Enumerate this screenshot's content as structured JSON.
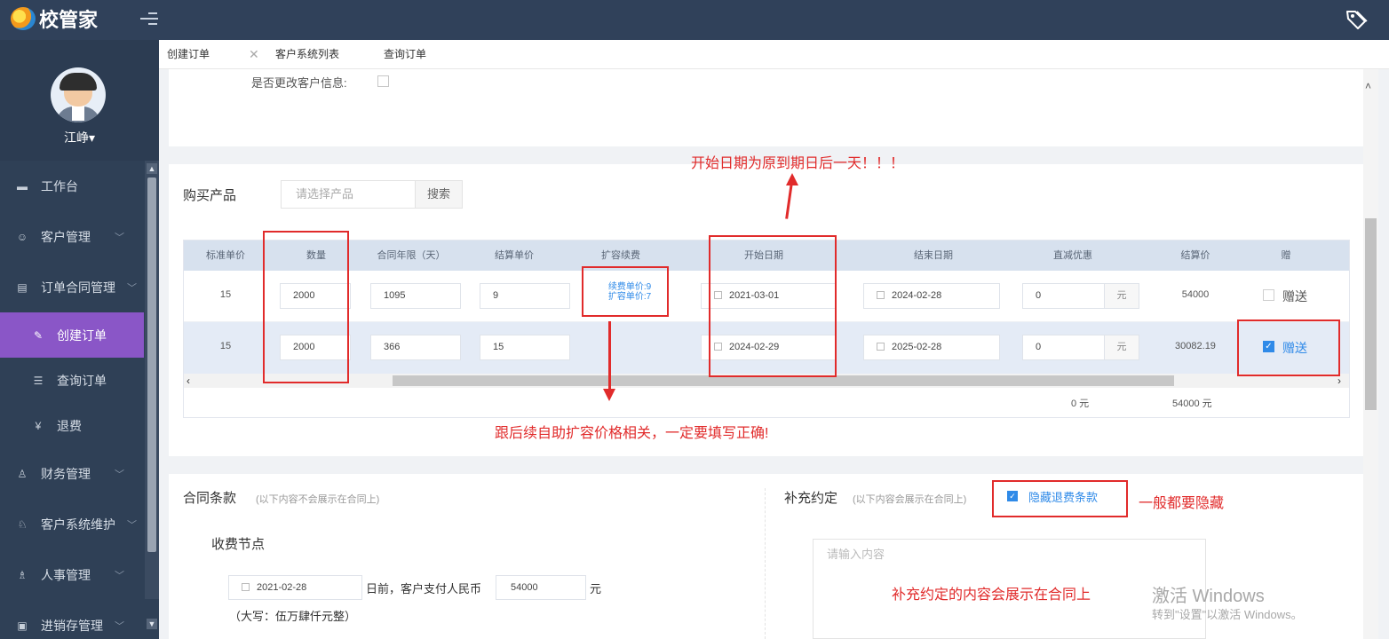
{
  "app": {
    "brand": "校管家"
  },
  "user": {
    "name": "江峥▾"
  },
  "sidebar": {
    "items": [
      {
        "label": "工作台",
        "icon": "desk-icon"
      },
      {
        "label": "客户管理",
        "icon": "customer-icon"
      },
      {
        "label": "订单合同管理",
        "icon": "contract-icon"
      },
      {
        "label": "创建订单",
        "icon": "create-order-icon",
        "active": true
      },
      {
        "label": "查询订单",
        "icon": "query-order-icon"
      },
      {
        "label": "退费",
        "icon": "refund-icon"
      },
      {
        "label": "财务管理",
        "icon": "finance-icon"
      },
      {
        "label": "客户系统维护",
        "icon": "maintenance-icon"
      },
      {
        "label": "人事管理",
        "icon": "hr-icon"
      },
      {
        "label": "进销存管理",
        "icon": "inventory-icon"
      }
    ]
  },
  "tabs": [
    {
      "label": "创建订单",
      "active": true
    },
    {
      "label": "客户系统列表"
    },
    {
      "label": "查询订单"
    }
  ],
  "form": {
    "partial_label": "是否更改客户信息:",
    "product_section": "购买产品",
    "product_placeholder": "请选择产品",
    "search_label": "搜索"
  },
  "table": {
    "headers": [
      "标准单价",
      "数量",
      "合同年限（天）",
      "结算单价",
      "扩容续费",
      "开始日期",
      "结束日期",
      "直减优惠",
      "结算价",
      "赠"
    ],
    "rows": [
      {
        "std_price": "15",
        "qty": "2000",
        "days": "1095",
        "settle_unit": "9",
        "renew_note": "续费单价:9",
        "expand_note": "扩容单价:7",
        "start": "2021-03-01",
        "end": "2024-02-28",
        "discount": "0",
        "unit": "元",
        "settle": "54000",
        "gift_label": "赠送",
        "gift": false
      },
      {
        "std_price": "15",
        "qty": "2000",
        "days": "366",
        "settle_unit": "15",
        "renew_note": "",
        "expand_note": "",
        "start": "2024-02-29",
        "end": "2025-02-28",
        "discount": "0",
        "unit": "元",
        "settle": "30082.19",
        "gift_label": "赠送",
        "gift": true
      }
    ],
    "footer": {
      "discount_total": "0 元",
      "settle_total": "54000 元"
    }
  },
  "contract": {
    "title": "合同条款",
    "note": "(以下内容不会展示在合同上)",
    "fee_node": "收费节点",
    "due_date": "2021-02-28",
    "before_text": "日前，客户支付人民币",
    "amount": "54000",
    "unit": "元",
    "capital": "（大写：伍万肆仟元整）"
  },
  "supplement": {
    "title": "补充约定",
    "note": "(以下内容会展示在合同上)",
    "hide_refund_label": "隐藏退费条款",
    "hide_refund_checked": true,
    "placeholder": "请输入内容"
  },
  "annotations": {
    "start_date": "开始日期为原到期日后一天！！！",
    "price_related": "跟后续自助扩容价格相关，一定要填写正确!",
    "hide_usually": "一般都要隐藏",
    "supplement_display": "补充约定的内容会展示在合同上"
  },
  "watermark": {
    "line1": "激活 Windows",
    "line2": "转到\"设置\"以激活 Windows。"
  },
  "colors": {
    "sidebar": "#2f4056",
    "topbar": "#30415a",
    "active": "#8a56c7",
    "accent": "#2f8ae8",
    "annotation": "#e12b2b"
  }
}
